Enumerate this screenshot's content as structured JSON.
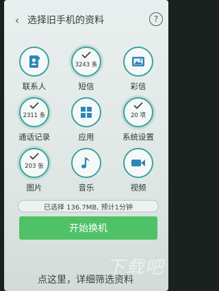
{
  "header": {
    "back_icon": "chevron-left-icon",
    "title": "选择旧手机的资料",
    "help_label": "?"
  },
  "items": [
    {
      "label": "联系人",
      "icon": "contacts-book-icon",
      "selected": false
    },
    {
      "label": "短信",
      "count": "3243 条",
      "selected": true
    },
    {
      "label": "彩信",
      "icon": "mms-image-icon",
      "selected": false
    },
    {
      "label": "通话记录",
      "count": "2311 条",
      "selected": true
    },
    {
      "label": "应用",
      "icon": "apps-grid-icon",
      "selected": false
    },
    {
      "label": "系统设置",
      "count": "20 项",
      "selected": true
    },
    {
      "label": "图片",
      "count": "203 张",
      "selected": true
    },
    {
      "label": "音乐",
      "icon": "music-note-icon",
      "selected": false
    },
    {
      "label": "视频",
      "icon": "video-camera-icon",
      "selected": false
    }
  ],
  "summary": {
    "text": "已选择 136.7MB, 预计1分钟"
  },
  "start_button": {
    "label": "开始换机"
  },
  "bottom_link": {
    "text": "点这里，详细筛选资料"
  },
  "watermark": {
    "text": "下载吧"
  },
  "colors": {
    "accent": "#3aa19c",
    "primary_button": "#4fc167"
  }
}
